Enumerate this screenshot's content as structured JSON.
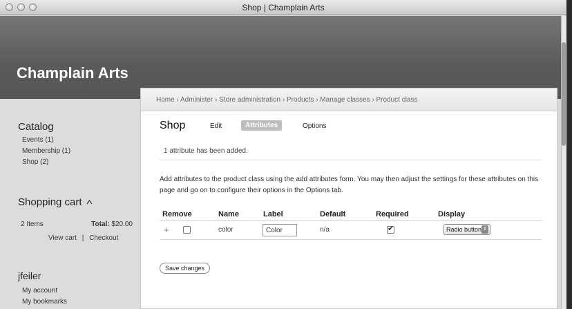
{
  "window": {
    "title": "Shop | Champlain Arts"
  },
  "site": {
    "name": "Champlain Arts"
  },
  "breadcrumb": "Home › Administer › Store administration › Products › Manage classes › Product class",
  "sidebar": {
    "catalog_title": "Catalog",
    "catalog_items": [
      "Events (1)",
      "Membership (1)",
      "Shop (2)"
    ],
    "cart_title": "Shopping cart",
    "cart_items": "2 Items",
    "cart_total_label": "Total:",
    "cart_total": "$20.00",
    "view_cart": "View cart",
    "separator": "|",
    "checkout": "Checkout",
    "user_name": "jfeiler",
    "user_links": [
      "My account",
      "My bookmarks"
    ]
  },
  "main": {
    "page_title": "Shop",
    "tabs": [
      {
        "label": "Edit",
        "active": false
      },
      {
        "label": "Attributes",
        "active": true
      },
      {
        "label": "Options",
        "active": false
      }
    ],
    "message": "1 attribute has been added.",
    "description": "Add attributes to the product class using the add attributes form. You may then adjust the settings for these attributes on this page and go on to configure their options in the Options tab.",
    "table": {
      "headers": [
        "Remove",
        "Name",
        "Label",
        "Default",
        "Required",
        "Display"
      ],
      "rows": [
        {
          "drag": "+",
          "remove": false,
          "name": "color",
          "label": "Color",
          "default": "n/a",
          "required": true,
          "display": "Radio buttons"
        }
      ]
    },
    "save_button": "Save changes"
  }
}
